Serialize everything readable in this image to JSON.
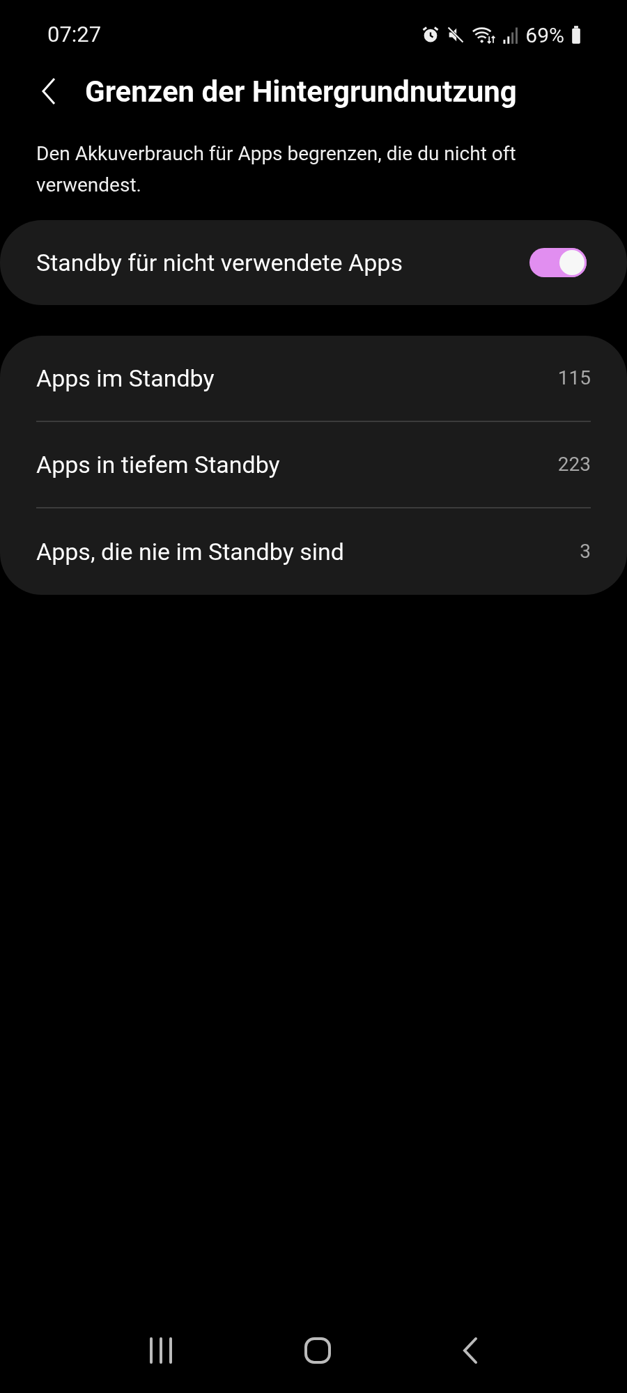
{
  "status_bar": {
    "time": "07:27",
    "battery": "69%"
  },
  "header": {
    "title": "Grenzen der Hintergrundnutzung"
  },
  "description": "Den Akkuverbrauch für Apps begrenzen, die du nicht oft verwendest.",
  "toggle_row": {
    "label": "Standby für nicht verwendete Apps",
    "on": true
  },
  "list": [
    {
      "label": "Apps im Standby",
      "count": "115"
    },
    {
      "label": "Apps in tiefem Standby",
      "count": "223"
    },
    {
      "label": "Apps, die nie im Standby sind",
      "count": "3"
    }
  ]
}
